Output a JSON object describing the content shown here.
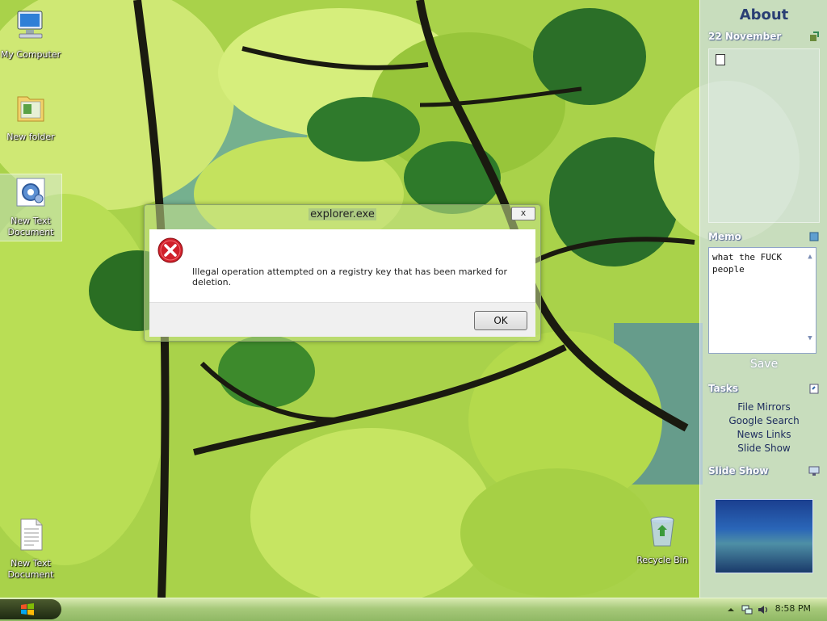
{
  "desktop": {
    "icons": [
      {
        "label": "My Computer"
      },
      {
        "label": "New folder"
      },
      {
        "label": "New Text Document"
      },
      {
        "label": "New Text Document"
      },
      {
        "label": "Recycle Bin"
      }
    ]
  },
  "sidebar": {
    "title": "About",
    "calendar": {
      "date": "22 November"
    },
    "memo": {
      "header": "Memo",
      "text": "what the FUCK people",
      "save_label": "Save"
    },
    "tasks": {
      "header": "Tasks",
      "items": [
        "File Mirrors",
        "Google Search",
        "News Links",
        "Slide Show"
      ]
    },
    "slideshow": {
      "header": "Slide Show"
    }
  },
  "dialog": {
    "title": "explorer.exe",
    "close_label": "x",
    "message": "Illegal operation attempted on a registry key that has been marked for deletion.",
    "ok_label": "OK"
  },
  "taskbar": {
    "clock": "8:58 PM"
  },
  "colors": {
    "sidebar_title": "#2a3f74",
    "error_red": "#d0202a",
    "taskbar_green": "#a7c97a"
  }
}
